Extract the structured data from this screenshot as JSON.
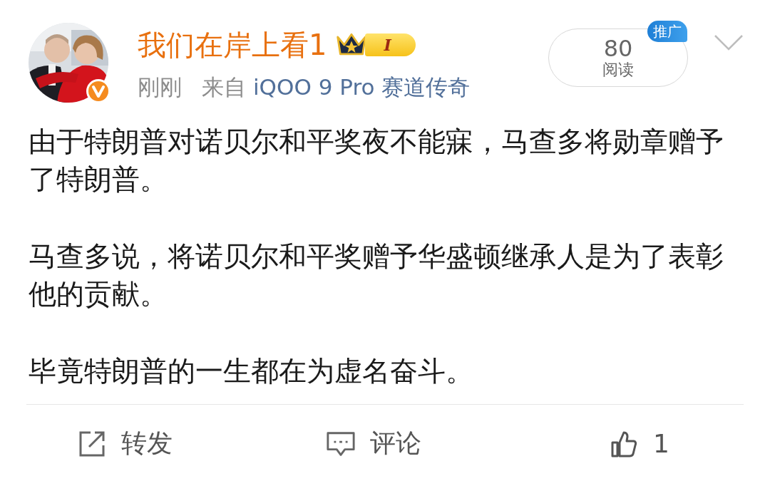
{
  "author": {
    "name": "我们在岸上看1",
    "level_badge": "I",
    "verified": true
  },
  "meta": {
    "time": "刚刚",
    "source_prefix": "来自",
    "source": "iQOO 9 Pro 赛道传奇"
  },
  "reads": {
    "count": "80",
    "label": "阅读",
    "promo_tag": "推广"
  },
  "paragraphs": [
    "由于特朗普对诺贝尔和平奖夜不能寐，马查多将勋章赠予了特朗普。",
    "马查多说，将诺贝尔和平奖赠予华盛顿继承人是为了表彰他的贡献。",
    "毕竟特朗普的一生都在为虚名奋斗。"
  ],
  "actions": [
    {
      "kind": "repost",
      "label": "转发"
    },
    {
      "kind": "comment",
      "label": "评论"
    },
    {
      "kind": "like",
      "label": "1"
    }
  ]
}
